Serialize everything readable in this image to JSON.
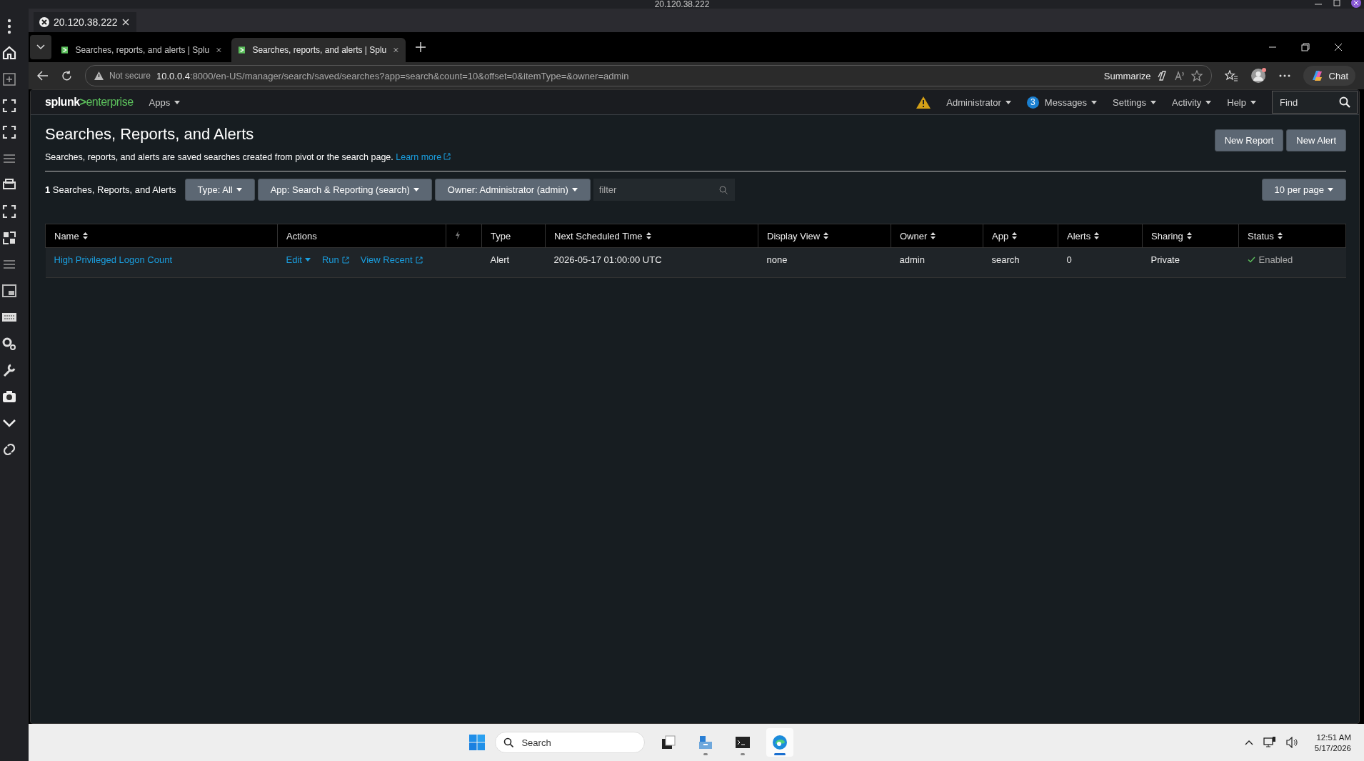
{
  "remote_window": {
    "title": "20.120.38.222"
  },
  "session_tab": {
    "label": "20.120.38.222"
  },
  "browser": {
    "tabs": [
      {
        "title": "Searches, reports, and alerts | Splu",
        "selected": false
      },
      {
        "title": "Searches, reports, and alerts | Splu",
        "selected": true
      }
    ],
    "address": {
      "security": "Not secure",
      "host": "10.0.0.4",
      "path": ":8000/en-US/manager/search/saved/searches?app=search&count=10&offset=0&itemType=&owner=admin"
    },
    "summarize": "Summarize",
    "chat": "Chat"
  },
  "splunk_nav": {
    "logo_left": "splunk",
    "logo_mark": ">",
    "logo_right": "enterprise",
    "apps": "Apps",
    "menus": [
      {
        "label": "Administrator"
      },
      {
        "label": "Messages",
        "badge": "3"
      },
      {
        "label": "Settings"
      },
      {
        "label": "Activity"
      },
      {
        "label": "Help"
      }
    ],
    "find_placeholder": "Find"
  },
  "page": {
    "title": "Searches, Reports, and Alerts",
    "description": "Searches, reports, and alerts are saved searches created from pivot or the search page.",
    "learn_more": "Learn more",
    "buttons": [
      "New Report",
      "New Alert"
    ],
    "count": "1",
    "count_label": "Searches, Reports, and Alerts",
    "filters": [
      "Type: All",
      "App: Search & Reporting (search)",
      "Owner: Administrator (admin)"
    ],
    "filter_placeholder": "filter",
    "per_page": "10 per page"
  },
  "table": {
    "columns": [
      {
        "kind": "text",
        "label": "Name",
        "sortable": true
      },
      {
        "kind": "text",
        "label": "Actions",
        "sortable": false
      },
      {
        "kind": "icon"
      },
      {
        "kind": "text",
        "label": "Type",
        "sortable": false
      },
      {
        "kind": "text",
        "label": "Next Scheduled Time",
        "sortable": true
      },
      {
        "kind": "text",
        "label": "Display View",
        "sortable": true
      },
      {
        "kind": "text",
        "label": "Owner",
        "sortable": true
      },
      {
        "kind": "text",
        "label": "App",
        "sortable": true
      },
      {
        "kind": "text",
        "label": "Alerts",
        "sortable": true
      },
      {
        "kind": "text",
        "label": "Sharing",
        "sortable": true
      },
      {
        "kind": "text",
        "label": "Status",
        "sortable": true
      }
    ],
    "rows": [
      {
        "name": "High Privileged Logon Count",
        "actions": [
          {
            "label": "Edit",
            "kind": "menu"
          },
          {
            "label": "Run",
            "kind": "external"
          },
          {
            "label": "View Recent",
            "kind": "external"
          }
        ],
        "type": "Alert",
        "next_scheduled_time": "2026-05-17 01:00:00 UTC",
        "display_view": "none",
        "owner": "admin",
        "app": "search",
        "alerts": "0",
        "sharing": "Private",
        "status": "Enabled",
        "enabled": true
      }
    ]
  },
  "taskbar": {
    "search_placeholder": "Search",
    "apps": [
      {
        "kind": "task-view",
        "active": false,
        "running": false
      },
      {
        "kind": "files",
        "active": false,
        "running": true
      },
      {
        "kind": "terminal",
        "active": false,
        "running": true
      },
      {
        "kind": "browser",
        "active": true,
        "running": true
      }
    ],
    "time": "12:51 AM",
    "date": "5/17/2026"
  }
}
